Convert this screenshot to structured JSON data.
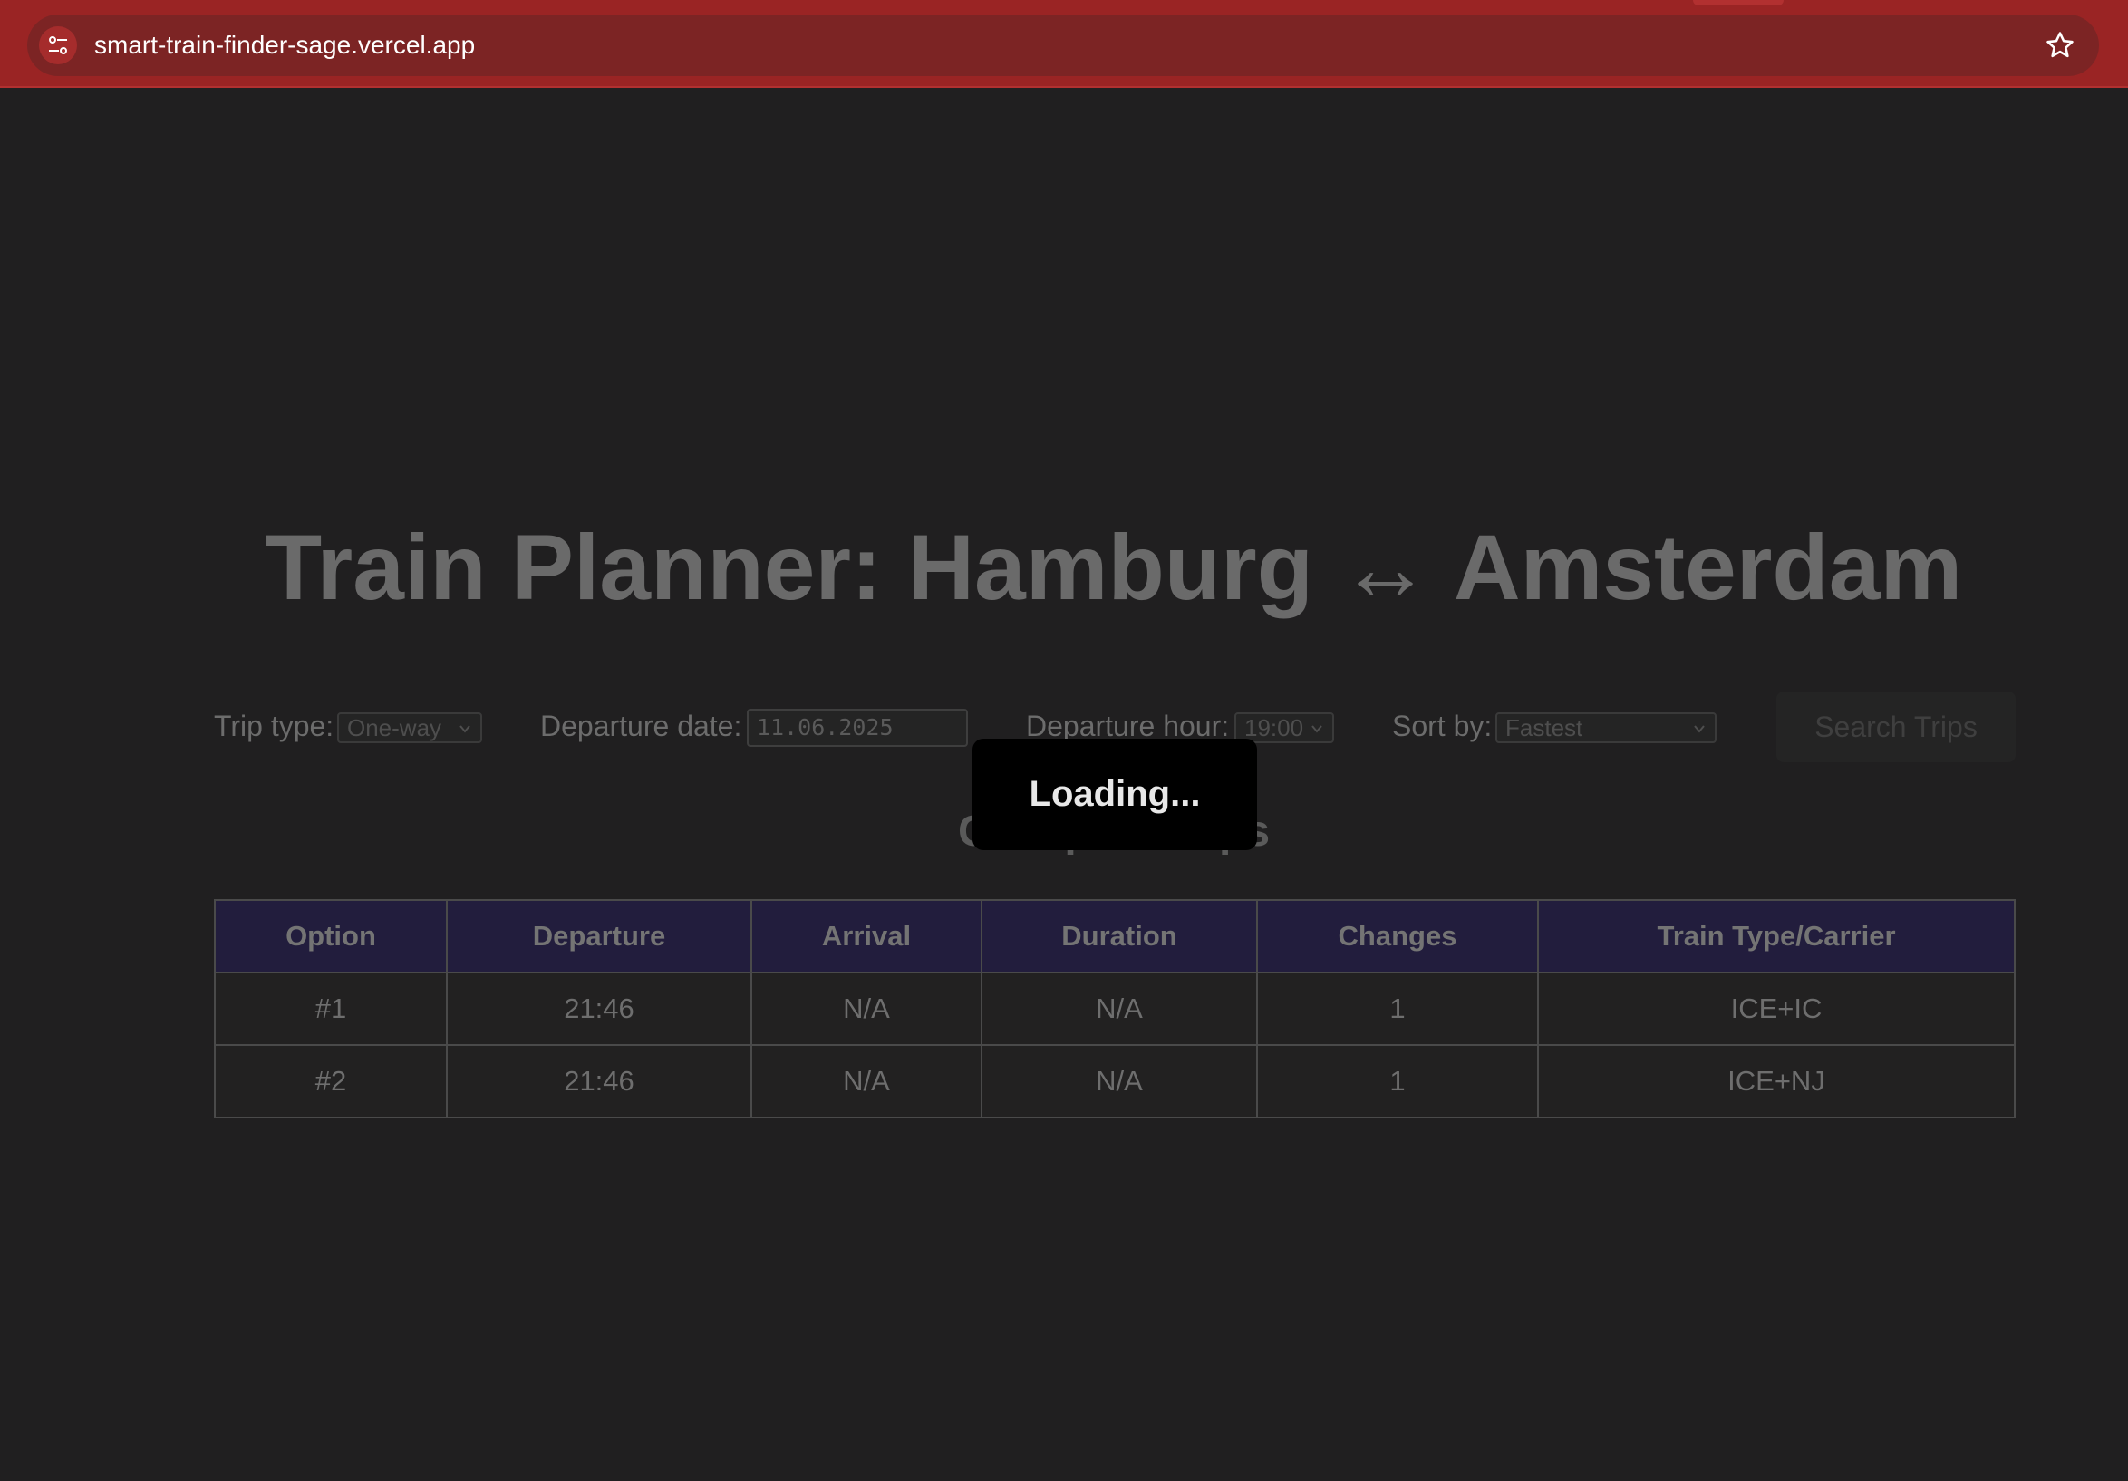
{
  "browser": {
    "url": "smart-train-finder-sage.vercel.app",
    "site_info_icon": "tune-icon",
    "bookmark_icon": "star-icon"
  },
  "page": {
    "title": "Train Planner: Hamburg ↔ Amsterdam",
    "section_heading": "Cheapest Trips",
    "loading_text": "Loading..."
  },
  "form": {
    "trip_type_label": "Trip type:",
    "trip_type_value": "One-way",
    "departure_date_label": "Departure date:",
    "departure_date_value": "11.06.2025",
    "departure_hour_label": "Departure hour:",
    "departure_hour_value": "19:00",
    "sort_by_label": "Sort by:",
    "sort_by_value": "Fastest",
    "search_button": "Search Trips"
  },
  "table": {
    "headers": [
      "Option",
      "Departure",
      "Arrival",
      "Duration",
      "Changes",
      "Train Type/Carrier"
    ],
    "rows": [
      [
        "#1",
        "21:46",
        "N/A",
        "N/A",
        "1",
        "ICE+IC"
      ],
      [
        "#2",
        "21:46",
        "N/A",
        "N/A",
        "1",
        "ICE+NJ"
      ]
    ]
  },
  "colors": {
    "browser_bar": "#9a2424",
    "page_bg": "#201f20",
    "table_header_bg": "#221d3d",
    "loading_bg": "#000000"
  }
}
